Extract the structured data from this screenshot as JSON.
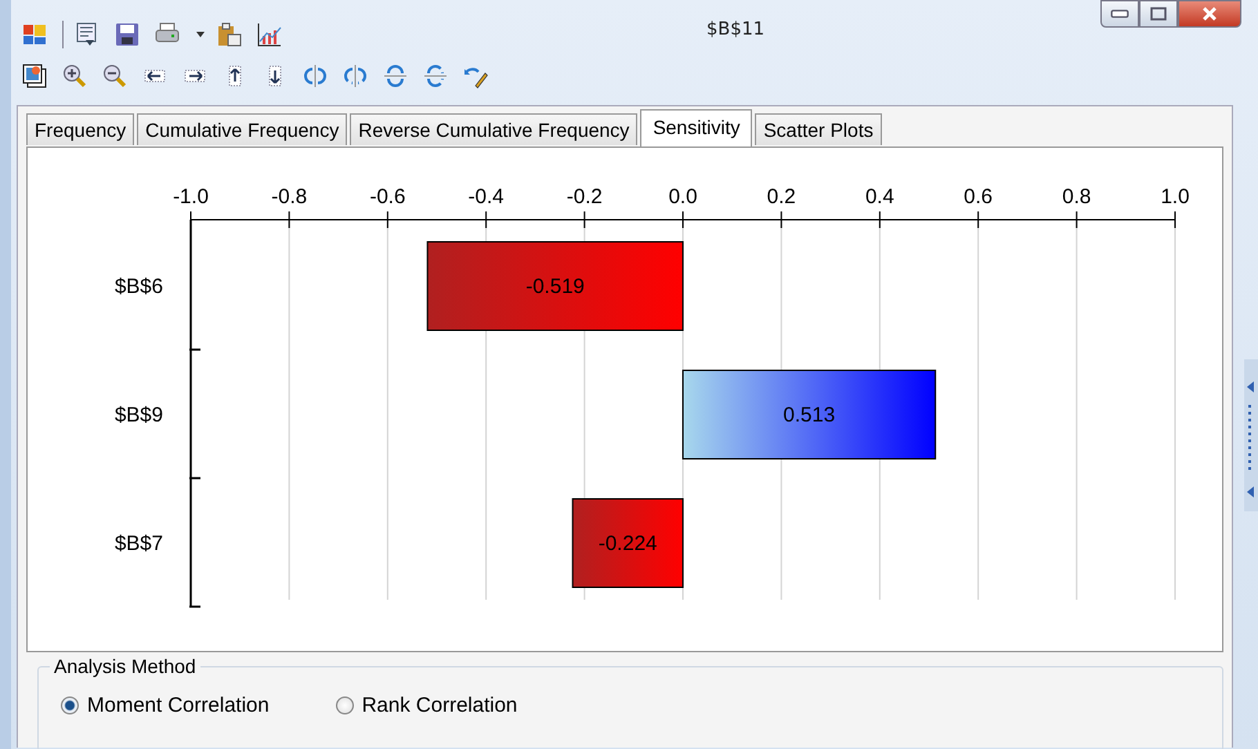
{
  "window": {
    "title": "$B$11"
  },
  "tabs": [
    {
      "label": "Frequency",
      "selected": false
    },
    {
      "label": "Cumulative Frequency",
      "selected": false
    },
    {
      "label": "Reverse Cumulative Frequency",
      "selected": false
    },
    {
      "label": "Sensitivity",
      "selected": true
    },
    {
      "label": "Scatter Plots",
      "selected": false
    }
  ],
  "chart_data": {
    "type": "bar",
    "orientation": "horizontal",
    "categories": [
      "$B$6",
      "$B$9",
      "$B$7"
    ],
    "values": [
      -0.519,
      0.513,
      -0.224
    ],
    "grid": true,
    "xlim": [
      -1,
      1
    ],
    "xticks": [
      {
        "value": -1,
        "label": "-1.0"
      },
      {
        "value": -0.8,
        "label": "-0.8"
      },
      {
        "value": -0.6,
        "label": "-0.6"
      },
      {
        "value": -0.4,
        "label": "-0.4"
      },
      {
        "value": -0.2,
        "label": "-0.2"
      },
      {
        "value": 0,
        "label": "0.0"
      },
      {
        "value": 0.2,
        "label": "0.2"
      },
      {
        "value": 0.4,
        "label": "0.4"
      },
      {
        "value": 0.6,
        "label": "0.6"
      },
      {
        "value": 0.8,
        "label": "0.8"
      },
      {
        "value": 1,
        "label": "1.0"
      }
    ],
    "data_labels": true
  },
  "analysis_method": {
    "title": "Analysis Method",
    "options": [
      {
        "label": "Moment Correlation",
        "selected": true
      },
      {
        "label": "Rank Correlation",
        "selected": false
      }
    ]
  }
}
